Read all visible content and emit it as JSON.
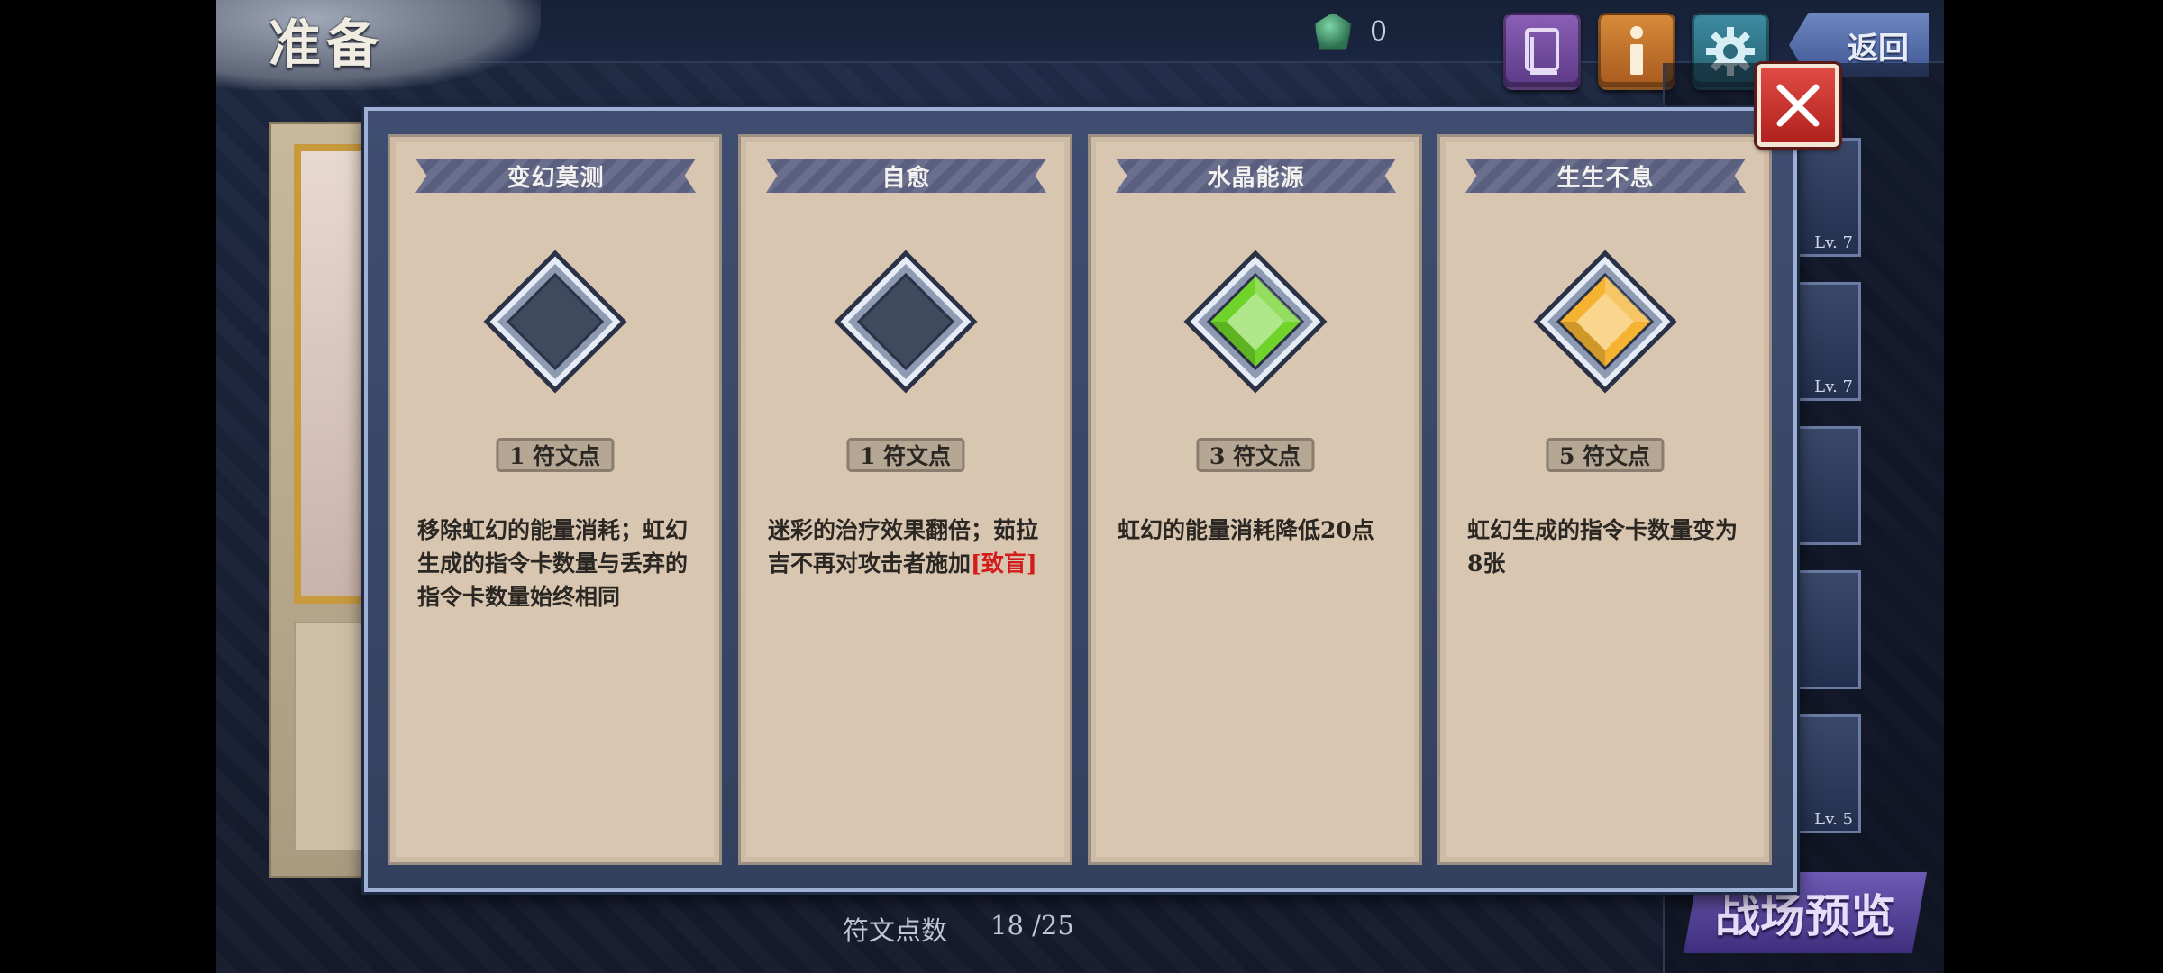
{
  "header": {
    "page_title": "准备",
    "currency_value": "0",
    "currency_icon": "gem-icon",
    "back_label": "返回",
    "buttons": [
      {
        "name": "codex-button",
        "icon": "book-icon"
      },
      {
        "name": "info-button",
        "icon": "info-icon"
      },
      {
        "name": "settings-button",
        "icon": "gear-icon"
      }
    ]
  },
  "side_cards": [
    {
      "level": "Lv. 7"
    },
    {
      "level": "Lv. 7"
    },
    {
      "level": ""
    },
    {
      "level": ""
    },
    {
      "level": "Lv. 5"
    }
  ],
  "footer": {
    "rune_label": "符文点数",
    "rune_value": "18 /25",
    "battle_preview_label": "战场预览"
  },
  "modal": {
    "close_icon": "close-icon",
    "cards": [
      {
        "title": "变幻莫测",
        "gem_color": "#3f4a5e",
        "gem_type": "empty",
        "cost": "1 符文点",
        "desc": "移除虹幻的能量消耗；虹幻生成的指令卡数量与丢弃的指令卡数量始终相同",
        "keyword": ""
      },
      {
        "title": "自愈",
        "gem_color": "#3f4a5e",
        "gem_type": "empty",
        "cost": "1 符文点",
        "desc": "迷彩的治疗效果翻倍；茹拉吉不再对攻击者施加",
        "keyword": "[致盲]"
      },
      {
        "title": "水晶能源",
        "gem_color": "#6fd32a",
        "gem_type": "green",
        "cost": "3 符文点",
        "desc": "虹幻的能量消耗降低20点",
        "keyword": ""
      },
      {
        "title": "生生不息",
        "gem_color": "#f5b331",
        "gem_type": "gold",
        "cost": "5 符文点",
        "desc": "虹幻生成的指令卡数量变为8张",
        "keyword": ""
      }
    ]
  }
}
